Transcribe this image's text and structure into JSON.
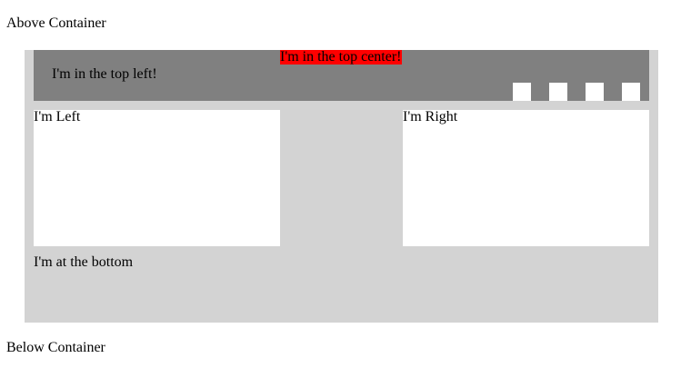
{
  "page": {
    "above_text": "Above Container",
    "below_text": "Below Container"
  },
  "container": {
    "top_bar": {
      "top_left_text": "I'm in the top left!",
      "top_center_text": "I'm in the top center!",
      "squares_count": 4
    },
    "left_box_label": "I'm Left",
    "right_box_label": "I'm Right",
    "bottom_text": "I'm at the bottom"
  },
  "colors": {
    "container_bg": "#d3d3d3",
    "top_bar_bg": "#808080",
    "highlight_red": "#ff0000",
    "box_bg": "#ffffff"
  }
}
